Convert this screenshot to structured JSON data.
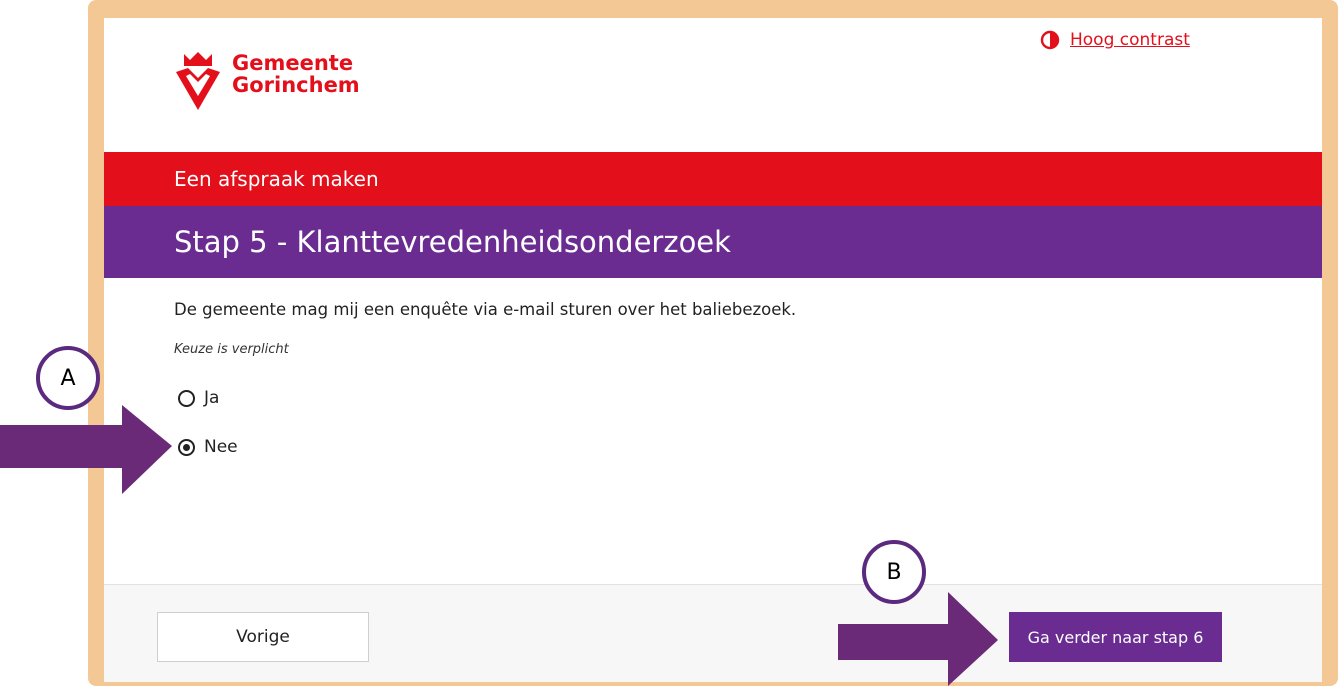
{
  "header": {
    "logo_line1": "Gemeente",
    "logo_line2": "Gorinchem",
    "contrast_label": "Hoog contrast"
  },
  "banner": {
    "title": "Een afspraak maken",
    "step_title": "Stap 5 - Klanttevredenheidsonderzoek"
  },
  "form": {
    "question": "De gemeente mag mij een enquête via e-mail sturen over het baliebezoek.",
    "required_note": "Keuze is verplicht",
    "options": [
      {
        "label": "Ja",
        "checked": false
      },
      {
        "label": "Nee",
        "checked": true
      }
    ]
  },
  "footer": {
    "prev_label": "Vorige",
    "next_label": "Ga verder naar stap 6"
  },
  "annotations": {
    "marker_a": "A",
    "marker_b": "B"
  },
  "colors": {
    "brand_red": "#e3101c",
    "brand_purple": "#6a2c91",
    "frame": "#f4c895",
    "arrow": "#6a2a78"
  }
}
